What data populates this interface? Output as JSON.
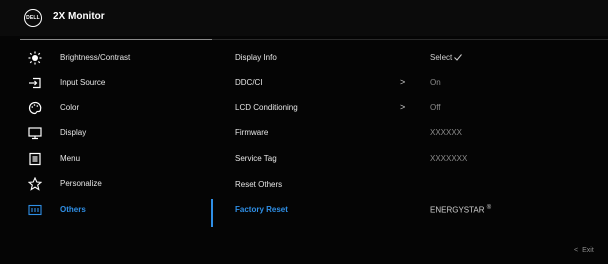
{
  "header": {
    "logo_text": "DELL",
    "title": "2X Monitor"
  },
  "menu": [
    {
      "label": "Brightness/Contrast",
      "icon": "brightness-icon"
    },
    {
      "label": "Input Source",
      "icon": "input-source-icon"
    },
    {
      "label": "Color",
      "icon": "color-palette-icon"
    },
    {
      "label": "Display",
      "icon": "display-icon"
    },
    {
      "label": "Menu",
      "icon": "menu-icon"
    },
    {
      "label": "Personalize",
      "icon": "star-icon"
    },
    {
      "label": "Others",
      "icon": "others-icon",
      "active": true
    }
  ],
  "submenu": [
    {
      "label": "Display Info",
      "chevron": "",
      "value": "Select"
    },
    {
      "label": "DDC/CI",
      "chevron": ">",
      "value": "On"
    },
    {
      "label": "LCD Conditioning",
      "chevron": ">",
      "value": "Off"
    },
    {
      "label": "Firmware",
      "chevron": "",
      "value": "XXXXXX"
    },
    {
      "label": "Service Tag",
      "chevron": "",
      "value": "XXXXXXX"
    },
    {
      "label": "Reset Others",
      "chevron": "",
      "value": ""
    },
    {
      "label": "Factory Reset",
      "chevron": "",
      "value": "ENERGYSTAR",
      "value_sup": "®",
      "active": true
    }
  ],
  "footer": {
    "exit_label": "Exit",
    "exit_icon": "chevron-left-icon"
  },
  "colors": {
    "accent": "#2f8fe6",
    "background": "#000000",
    "text": "#e6e6e6",
    "muted": "#8c8c8c"
  }
}
